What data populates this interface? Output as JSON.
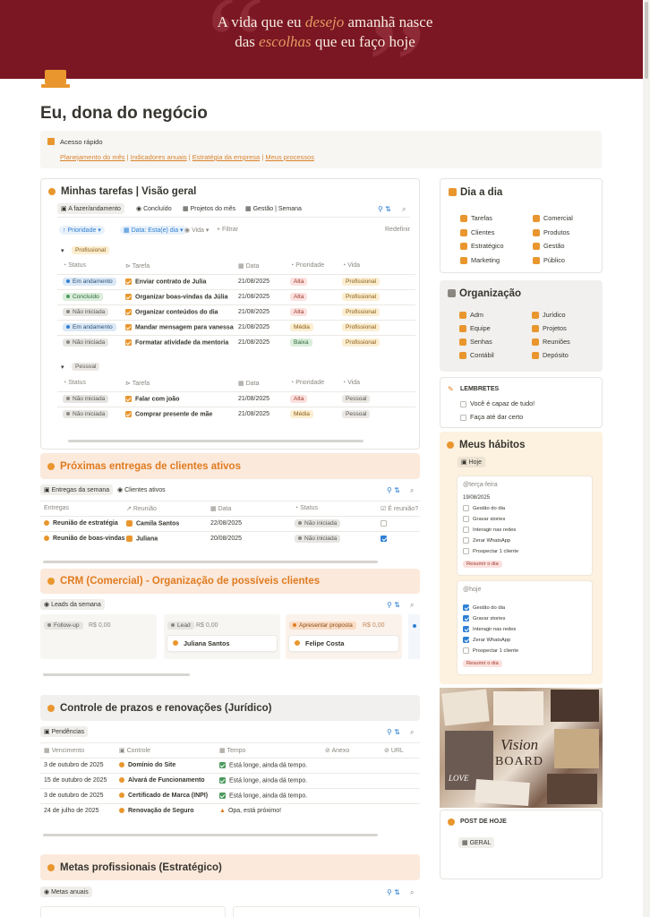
{
  "banner": {
    "line1": {
      "a": "A vida que eu ",
      "hl": "desejo",
      "b": " amanhã nasce"
    },
    "line2": {
      "a": "das ",
      "hl": "escolhas",
      "b": " que eu faço hoje"
    }
  },
  "page": {
    "title": "Eu, dona do negócio",
    "icon": "laptop-icon"
  },
  "quick": {
    "title": "Acesso rápido",
    "links": [
      "Planejamento do mês",
      "Indicadores anuais",
      "Estratégia da empresa",
      "Meus processos"
    ]
  },
  "tasks": {
    "title": "Minhas tarefas | Visão geral",
    "tabs": [
      "A fazer/andamento",
      "Concluído",
      "Projetos do mês",
      "Gestão | Semana"
    ],
    "filters": {
      "prioridade": "Prioridade",
      "data": "Data: Esta(e) dia",
      "vida": "Vida",
      "filtrar": "+ Filtrar",
      "redefinir": "Redefinir"
    },
    "columns": [
      "Status",
      "Tarefa",
      "Data",
      "Prioridade",
      "Vida"
    ],
    "groups": [
      {
        "name": "Profissional",
        "rows": [
          {
            "status": "Em andamento",
            "tarefa": "Enviar contrato de Julia",
            "data": "21/08/2025",
            "prioridade": "Alta",
            "vida": "Profissional"
          },
          {
            "status": "Concluído",
            "tarefa": "Organizar boas-vindas da Júlia",
            "data": "21/08/2025",
            "prioridade": "Alta",
            "vida": "Profissional"
          },
          {
            "status": "Não iniciada",
            "tarefa": "Organizar conteúdos do dia",
            "data": "21/08/2025",
            "prioridade": "Alta",
            "vida": "Profissional"
          },
          {
            "status": "Em andamento",
            "tarefa": "Mandar mensagem para vanessa",
            "data": "21/08/2025",
            "prioridade": "Média",
            "vida": "Profissional"
          },
          {
            "status": "Não iniciada",
            "tarefa": "Formatar atividade da mentoria",
            "data": "21/08/2025",
            "prioridade": "Baixa",
            "vida": "Profissional"
          }
        ]
      },
      {
        "name": "Pessoal",
        "rows": [
          {
            "status": "Não iniciada",
            "tarefa": "Falar com joão",
            "data": "21/08/2025",
            "prioridade": "Alta",
            "vida": "Pessoal"
          },
          {
            "status": "Não iniciada",
            "tarefa": "Comprar presente de mãe",
            "data": "21/08/2025",
            "prioridade": "Média",
            "vida": "Pessoal"
          }
        ]
      }
    ]
  },
  "entregas": {
    "title": "Próximas entregas de clientes ativos",
    "tabs": [
      "Entregas da semana",
      "Clientes ativos"
    ],
    "columns": [
      "Entregas",
      "Reunião",
      "Data",
      "Status",
      "É reunião?"
    ],
    "rows": [
      {
        "entrega": "Reunião de estratégia",
        "reuniao": "Camila Santos",
        "data": "22/08/2025",
        "status": "Não iniciada",
        "check": false
      },
      {
        "entrega": "Reunião de boas-vindas",
        "reuniao": "Juliana",
        "data": "20/08/2025",
        "status": "Não iniciada",
        "check": true
      }
    ]
  },
  "crm": {
    "title": "CRM (Comercial) - Organização de possíveis clientes",
    "tab": "Leads da semana",
    "columns": [
      {
        "name": "Follow-up",
        "value": "R$ 0,00",
        "cards": []
      },
      {
        "name": "Lead",
        "value": "R$ 0,00",
        "cards": [
          "Juliana Santos"
        ]
      },
      {
        "name": "Apresentar proposta",
        "value": "R$ 0,00",
        "cards": [
          "Felipe Costa"
        ]
      }
    ]
  },
  "juridico": {
    "title": "Controle de prazos e renovações (Jurídico)",
    "tab": "Pendências",
    "columns": [
      "Vencimento",
      "Controle",
      "Tempo",
      "Anexo",
      "URL"
    ],
    "rows": [
      {
        "venc": "3 de outubro de 2025",
        "controle": "Domínio do Site",
        "tempo": "Está longe, ainda dá tempo."
      },
      {
        "venc": "15 de outubro de 2025",
        "controle": "Alvará de Funcionamento",
        "tempo": "Está longe, ainda dá tempo."
      },
      {
        "venc": "3 de outubro de 2025",
        "controle": "Certificado de Marca (INPI)",
        "tempo": "Está longe, ainda dá tempo."
      },
      {
        "venc": "24 de julho de 2025",
        "controle": "Renovação de Seguro",
        "tempo": "Opa, está próximo!"
      }
    ]
  },
  "metas": {
    "title": "Metas profissionais (Estratégico)",
    "tab": "Metas anuais"
  },
  "dia": {
    "title": "Dia a dia",
    "items": [
      [
        "Tarefas",
        "Comercial"
      ],
      [
        "Clientes",
        "Produtos"
      ],
      [
        "Estratégico",
        "Gestão"
      ],
      [
        "Marketing",
        "Público"
      ]
    ]
  },
  "org": {
    "title": "Organização",
    "items": [
      [
        "Adm",
        "Jurídico"
      ],
      [
        "Equipe",
        "Projetos"
      ],
      [
        "Senhas",
        "Reuniões"
      ],
      [
        "Contábil",
        "Depósito"
      ]
    ]
  },
  "lembretes": {
    "title": "LEMBRETES",
    "items": [
      "Você é capaz de tudo!",
      "Faça até dar certo"
    ]
  },
  "habitos": {
    "title": "Meus hábitos",
    "tab": "Hoje",
    "cards": [
      {
        "title": "@terça-feira",
        "date": "19/08/2025",
        "items": [
          {
            "label": "Gestão do dia",
            "on": false
          },
          {
            "label": "Gravar stories",
            "on": false
          },
          {
            "label": "Interagir nas redes",
            "on": false
          },
          {
            "label": "Zerar WhatsApp",
            "on": false
          },
          {
            "label": "Prospectar 1 cliente",
            "on": false
          }
        ],
        "badge": "Resumir o dia"
      },
      {
        "title": "@hoje",
        "date": "",
        "items": [
          {
            "label": "Gestão do dia",
            "on": true
          },
          {
            "label": "Gravar stories",
            "on": true
          },
          {
            "label": "Interagir nas redes",
            "on": true
          },
          {
            "label": "Zerar WhatsApp",
            "on": true
          },
          {
            "label": "Prospectar 1 cliente",
            "on": false
          }
        ],
        "badge": "Resumir o dia"
      }
    ]
  },
  "vision": {
    "line1": "Vision",
    "line2": "BOARD",
    "love": "LOVE"
  },
  "post": {
    "title": "POST DE HOJE",
    "tab": "GERAL"
  },
  "colors": {
    "banner": "#7b1723",
    "accent": "#e9962e",
    "band": "#fbe9dc"
  }
}
